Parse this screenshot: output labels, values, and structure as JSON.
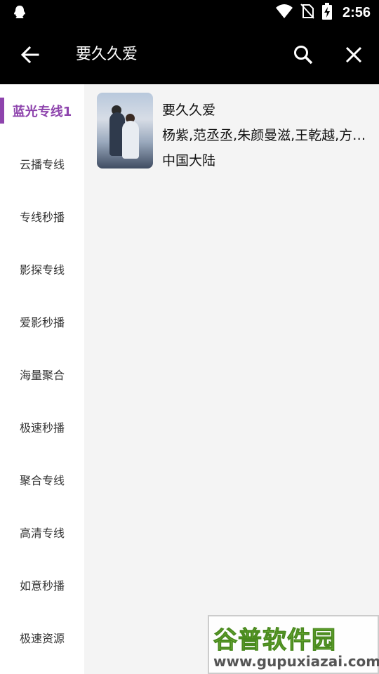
{
  "status_bar": {
    "time": "2:56",
    "icons": [
      "qq-notification-icon",
      "wifi-icon",
      "no-sim-icon",
      "battery-charging-icon"
    ]
  },
  "toolbar": {
    "search_query": "要久久爱",
    "back_icon": "arrow-left-icon",
    "search_icon": "search-icon",
    "close_icon": "close-icon"
  },
  "sidebar": {
    "accent_color": "#8e44ad",
    "items": [
      {
        "label": "蓝光专线1",
        "active": true
      },
      {
        "label": "云播专线",
        "active": false
      },
      {
        "label": "专线秒播",
        "active": false
      },
      {
        "label": "影探专线",
        "active": false
      },
      {
        "label": "爱影秒播",
        "active": false
      },
      {
        "label": "海量聚合",
        "active": false
      },
      {
        "label": "极速秒播",
        "active": false
      },
      {
        "label": "聚合专线",
        "active": false
      },
      {
        "label": "高清专线",
        "active": false
      },
      {
        "label": "如意秒播",
        "active": false
      },
      {
        "label": "极速资源",
        "active": false
      }
    ]
  },
  "results": [
    {
      "title": "要久久爱",
      "cast": "杨紫,范丞丞,朱颜曼滋,王乾越,方…",
      "region": "中国大陆"
    }
  ],
  "watermark": {
    "brand": "谷普软件园",
    "url": "www.gupuxiazai.com"
  }
}
